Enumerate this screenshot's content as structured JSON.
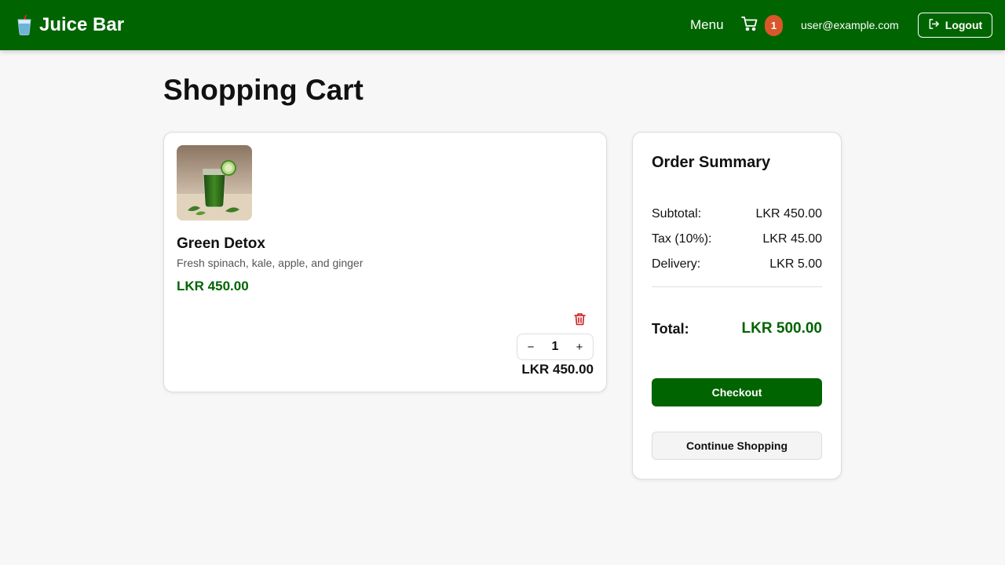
{
  "header": {
    "brand_title": "Juice Bar",
    "brand_icon": "juice-cup-icon",
    "menu_label": "Menu",
    "cart_icon": "cart-icon",
    "cart_count": "1",
    "user_email": "user@example.com",
    "logout_label": "Logout",
    "logout_icon": "logout-icon"
  },
  "page": {
    "title": "Shopping Cart"
  },
  "cart": {
    "items": [
      {
        "name": "Green Detox",
        "description": "Fresh spinach, kale, apple, and ginger",
        "price": "LKR 450.00",
        "quantity": "1",
        "decrement_label": "−",
        "increment_label": "+",
        "line_total": "LKR 450.00",
        "remove_icon": "trash-icon"
      }
    ]
  },
  "summary": {
    "title": "Order Summary",
    "rows": [
      {
        "label": "Subtotal:",
        "value": "LKR 450.00"
      },
      {
        "label": "Tax (10%):",
        "value": "LKR 45.00"
      },
      {
        "label": "Delivery:",
        "value": "LKR 5.00"
      }
    ],
    "total_label": "Total:",
    "total_value": "LKR 500.00",
    "checkout_label": "Checkout",
    "continue_label": "Continue Shopping"
  },
  "colors": {
    "brand": "#006400",
    "badge": "#d9572a",
    "delete": "#cc1f1f",
    "background": "#f7f7f7"
  }
}
